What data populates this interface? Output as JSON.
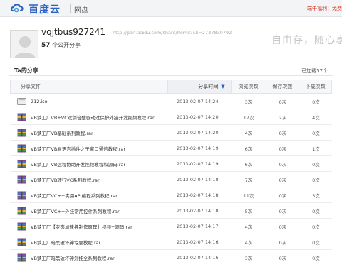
{
  "header": {
    "brand": "百度云",
    "subtitle": "网盘",
    "top_right": "端午福利：免费"
  },
  "profile": {
    "username": "vqjtbus927241",
    "share_url": "http://pan.baidu.com/share/home?uk=2737830792",
    "share_count_num": "57",
    "share_count_text": "个公开分享",
    "slogan": "自由存，随心享"
  },
  "section": {
    "title": "Ta的分享",
    "loaded": "已加载57个"
  },
  "table": {
    "columns": {
      "file": "分享文件",
      "time": "分享时间",
      "views": "浏览次数",
      "saves": "保存次数",
      "downloads": "下载次数"
    },
    "rows": [
      {
        "icon": "iso-file-icon",
        "name": "212.iso",
        "time": "2013-02-07 14:24",
        "views": "3次",
        "saves": "0次",
        "downloads": "0次"
      },
      {
        "icon": "rar-archive-icon",
        "name": "VB梦工厂VB+VC双剑合璧驱动过保护外挂开发视频教程.rar",
        "time": "2013-02-07 14:20",
        "views": "17次",
        "saves": "2次",
        "downloads": "4次"
      },
      {
        "icon": "rar-archive-icon",
        "name": "VB梦工厂VB基础系列教程.rar",
        "time": "2013-02-07 14:20",
        "views": "4次",
        "saves": "0次",
        "downloads": "0次"
      },
      {
        "icon": "rar-archive-icon",
        "name": "VB梦工厂VB易语言插件之子窗口通信教程.rar",
        "time": "2013-02-07 14:19",
        "views": "6次",
        "saves": "0次",
        "downloads": "1次"
      },
      {
        "icon": "rar-archive-icon",
        "name": "VB梦工厂VB远程协助开发视频教程和源码.rar",
        "time": "2013-02-07 14:19",
        "views": "6次",
        "saves": "0次",
        "downloads": "0次"
      },
      {
        "icon": "rar-archive-icon",
        "name": "VB梦工厂VB转行VC系列教程.rar",
        "time": "2013-02-07 14:18",
        "views": "7次",
        "saves": "0次",
        "downloads": "0次"
      },
      {
        "icon": "rar-archive-icon",
        "name": "VB梦工厂VC++实用API编程系列教程.rar",
        "time": "2013-02-07 14:18",
        "views": "11次",
        "saves": "0次",
        "downloads": "3次"
      },
      {
        "icon": "rar-archive-icon",
        "name": "VB梦工厂VC++外挂常用控件系列教程.rar",
        "time": "2013-02-07 14:18",
        "views": "5次",
        "saves": "0次",
        "downloads": "0次"
      },
      {
        "icon": "rar-archive-icon",
        "name": "VB梦工厂【变态加速挂制作原理】视频+源码.rar",
        "time": "2013-02-07 14:17",
        "views": "4次",
        "saves": "0次",
        "downloads": "0次"
      },
      {
        "icon": "rar-archive-icon",
        "name": "VB梦工厂暗黑破坏神专题教程.rar",
        "time": "2013-02-07 14:16",
        "views": "4次",
        "saves": "0次",
        "downloads": "0次"
      },
      {
        "icon": "rar-archive-icon",
        "name": "VB梦工厂暗黑破坏神外挂全系列教程.rar",
        "time": "2013-02-07 14:16",
        "views": "3次",
        "saves": "0次",
        "downloads": "0次"
      }
    ]
  }
}
